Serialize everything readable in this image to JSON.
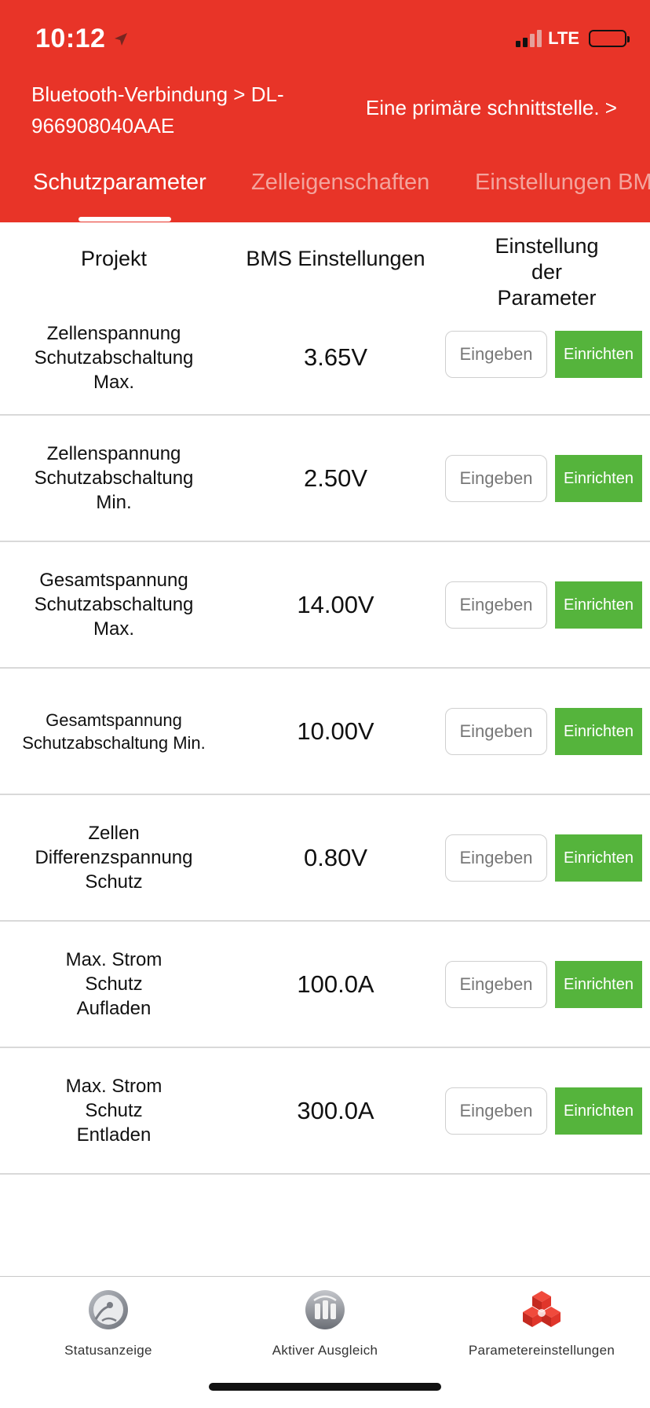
{
  "status_bar": {
    "time": "10:12",
    "network": "LTE"
  },
  "header": {
    "bluetooth_link": "Bluetooth-Verbindung > DL-966908040AAE",
    "primary_link": "Eine primäre schnittstelle. >",
    "background_color": "#e83428"
  },
  "tabs": [
    {
      "label": "Schutzparameter",
      "active": true
    },
    {
      "label": "Zelleigenschaften",
      "active": false
    },
    {
      "label": "Einstellungen BMS",
      "active": false
    }
  ],
  "table": {
    "headers": {
      "project": "Projekt",
      "bms": "BMS Einstellungen",
      "param": "Einstellung der Parameter"
    },
    "rows": [
      {
        "label": "Zellenspannung Schutzabschaltung Max.",
        "value": "3.65V",
        "input_label": "Eingeben",
        "set_label": "Einrichten"
      },
      {
        "label": "Zellenspannung Schutzabschaltung Min.",
        "value": "2.50V",
        "input_label": "Eingeben",
        "set_label": "Einrichten"
      },
      {
        "label": "Gesamtspannung Schutzabschaltung Max.",
        "value": "14.00V",
        "input_label": "Eingeben",
        "set_label": "Einrichten"
      },
      {
        "label": "Gesamtspannung Schutzabschaltung Min.",
        "value": "10.00V",
        "input_label": "Eingeben",
        "set_label": "Einrichten"
      },
      {
        "label": "Zellen Differenzspannung Schutz",
        "value": "0.80V",
        "input_label": "Eingeben",
        "set_label": "Einrichten"
      },
      {
        "label": "Max. Strom Schutz Aufladen",
        "value": "100.0A",
        "input_label": "Eingeben",
        "set_label": "Einrichten"
      },
      {
        "label": "Max. Strom Schutz Entladen",
        "value": "300.0A",
        "input_label": "Eingeben",
        "set_label": "Einrichten"
      }
    ]
  },
  "tabbar": {
    "items": [
      {
        "label": "Statusanzeige",
        "icon": "gauge-icon"
      },
      {
        "label": "Aktiver Ausgleich",
        "icon": "balance-icon"
      },
      {
        "label": "Parametereinstellungen",
        "icon": "cubes-icon"
      }
    ]
  },
  "colors": {
    "accent_red": "#e83428",
    "set_button_green": "#55b43c"
  }
}
